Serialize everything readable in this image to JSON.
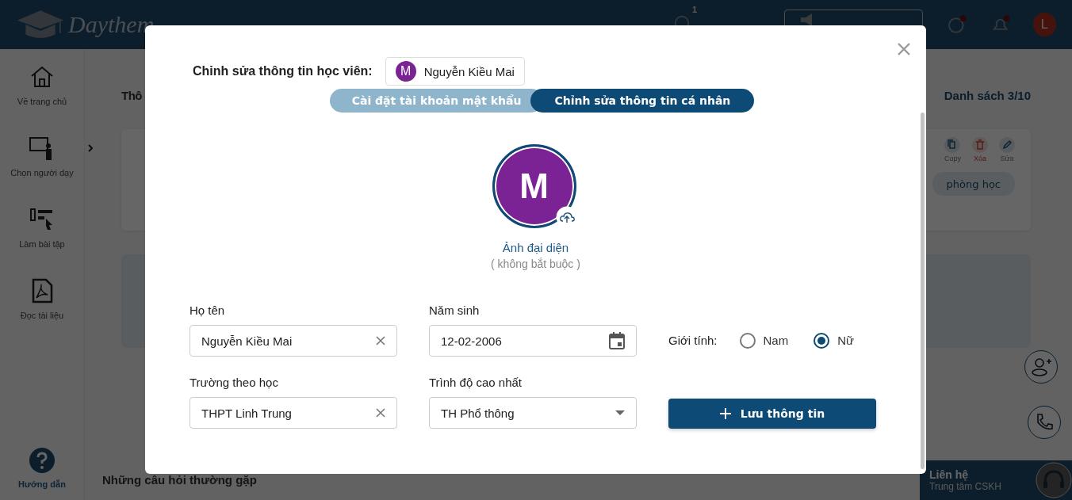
{
  "header": {
    "logo": "Daythem",
    "message_count": "1",
    "avatar_letter": "L"
  },
  "sidebar": {
    "items": [
      {
        "label": "Về trang chủ",
        "kind": "home"
      },
      {
        "label": "Chọn người dạy",
        "kind": "teacher"
      },
      {
        "label": "Làm bài tập",
        "kind": "exercise"
      },
      {
        "label": "Đọc tài liệu",
        "kind": "pdf"
      }
    ],
    "help": "Hướng dẫn"
  },
  "main": {
    "title": "Thô",
    "list_count": "Danh sách 3/10",
    "card_actions": [
      {
        "label": "Copy",
        "kind": "copy"
      },
      {
        "label": "Xóa",
        "kind": "delete"
      },
      {
        "label": "Sửa",
        "kind": "edit"
      }
    ],
    "room_button": "phòng học",
    "faq": "Những câu hỏi thường gặp"
  },
  "contact": {
    "title": "Liên hệ",
    "subtitle": "Trung tâm CSKH"
  },
  "modal": {
    "heading": "Chỉnh sửa thông tin học viên:",
    "student": {
      "initial": "M",
      "name": "Nguyễn Kiều Mai"
    },
    "tabs": [
      {
        "label": "Cài đặt tài khoản mật khẩu",
        "selected": false
      },
      {
        "label": "Chỉnh sửa thông tin cá nhân",
        "selected": true
      }
    ],
    "avatar": {
      "initial": "M",
      "label": "Ảnh đại diện",
      "note": "( không bắt buộc )"
    },
    "fields": [
      {
        "label": "Họ tên",
        "value": "Nguyễn Kiều Mai",
        "kind": "clear"
      },
      {
        "label": "Năm sinh",
        "value": "12-02-2006",
        "kind": "date"
      },
      {
        "label": "Trường theo học",
        "value": "THPT Linh Trung",
        "kind": "clear"
      },
      {
        "label": "Trình độ cao nhất",
        "value": "TH Phổ thông",
        "kind": "select"
      }
    ],
    "gender": {
      "label": "Giới tính:",
      "options": [
        {
          "label": "Nam",
          "selected": false
        },
        {
          "label": "Nữ",
          "selected": true
        }
      ]
    },
    "save_button": "Lưu thông tin"
  }
}
